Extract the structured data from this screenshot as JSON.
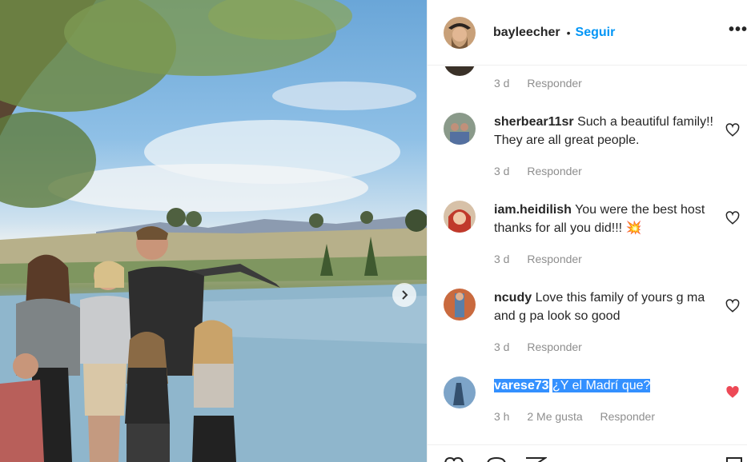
{
  "header": {
    "username": "bayleecher",
    "separator": "•",
    "follow_label": "Seguir",
    "more_label": "•••"
  },
  "comments": [
    {
      "time": "3 d",
      "reply": "Responder"
    },
    {
      "username": "sherbear11sr",
      "text": "Such a beautiful family!! They are all great people.",
      "time": "3 d",
      "reply": "Responder"
    },
    {
      "username": "iam.heidilish",
      "text": "You were the best host thanks for all you did!!! 💥",
      "time": "3 d",
      "reply": "Responder"
    },
    {
      "username": "ncudy",
      "text": "Love this family of yours g ma and g pa look so good",
      "time": "3 d",
      "reply": "Responder"
    },
    {
      "username": "varese73",
      "text": "¿Y el Madrí que?",
      "time": "3 h",
      "likes": "2 Me gusta",
      "reply": "Responder",
      "liked": true
    }
  ],
  "colors": {
    "link": "#0095f6",
    "liked_heart": "#ed4956",
    "meta": "#8e8e8e",
    "selection": "#3390ff"
  }
}
